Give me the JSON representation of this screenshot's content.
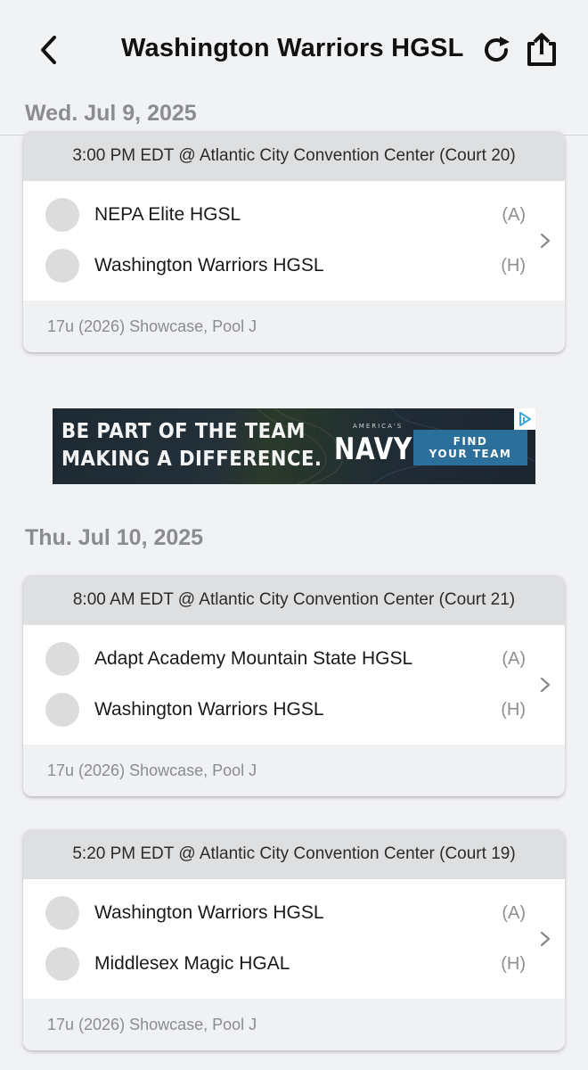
{
  "header": {
    "title": "Washington Warriors HGSL",
    "back_icon": "chevron-left-icon",
    "refresh_icon": "refresh-icon",
    "share_icon": "share-icon"
  },
  "days": [
    {
      "date": "Wed. Jul 9, 2025",
      "games": [
        {
          "time_location": "3:00 PM EDT @ Atlantic City Convention Center (Court 20)",
          "teams": [
            {
              "name": "NEPA Elite HGSL",
              "side": "(A)"
            },
            {
              "name": "Washington Warriors HGSL",
              "side": "(H)"
            }
          ],
          "division": "17u (2026) Showcase, Pool J"
        }
      ]
    },
    {
      "date": "Thu. Jul 10, 2025",
      "games": [
        {
          "time_location": "8:00 AM EDT @ Atlantic City Convention Center (Court 21)",
          "teams": [
            {
              "name": "Adapt Academy Mountain State HGSL",
              "side": "(A)"
            },
            {
              "name": "Washington Warriors HGSL",
              "side": "(H)"
            }
          ],
          "division": "17u (2026) Showcase, Pool J"
        },
        {
          "time_location": "5:20 PM EDT @ Atlantic City Convention Center (Court 19)",
          "teams": [
            {
              "name": "Washington Warriors HGSL",
              "side": "(A)"
            },
            {
              "name": "Middlesex Magic HGAL",
              "side": "(H)"
            }
          ],
          "division": "17u (2026) Showcase, Pool J"
        }
      ]
    }
  ],
  "ad": {
    "line1": "BE PART OF THE TEAM",
    "line2": "MAKING A DIFFERENCE.",
    "brand_small": "AMERICA'S",
    "brand": "NAVY",
    "cta_line1": "FIND",
    "cta_line2": "YOUR TEAM",
    "badge_icon": "adchoices-icon"
  },
  "colors": {
    "background": "#f1f2f4",
    "card_header": "#dedfe1",
    "muted_text": "#8a8c90",
    "ad_cta": "#2c6f9b"
  }
}
